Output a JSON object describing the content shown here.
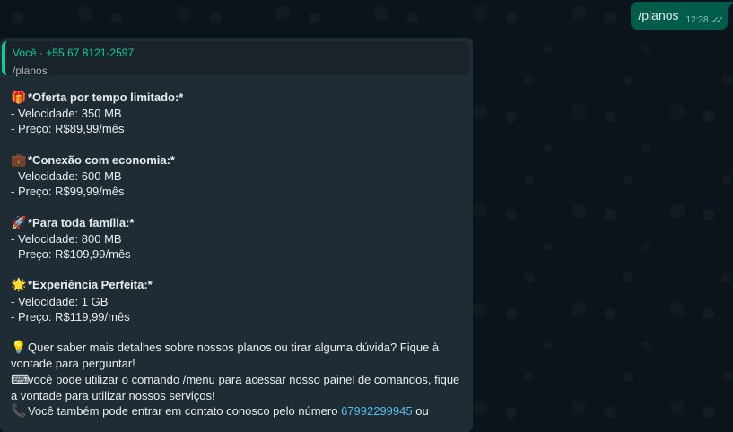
{
  "chat": {
    "outgoing": {
      "text": "/planos",
      "time": "12:38",
      "ticks": "✓✓"
    },
    "incoming": {
      "quote_author": "Você · +55 67 8121-2597",
      "quote_text": "/planos",
      "plans": [
        {
          "emoji": "🎁",
          "title": "*Oferta por tempo limitado:*",
          "speed": "- Velocidade: 350 MB",
          "price": "- Preço: R$89,99/mês"
        },
        {
          "emoji": "💼",
          "title": "*Conexão com economia:*",
          "speed": "- Velocidade: 600 MB",
          "price": "- Preço: R$99,99/mês"
        },
        {
          "emoji": "🚀",
          "title": "*Para toda família:*",
          "speed": "- Velocidade: 800 MB",
          "price": "- Preço: R$109,99/mês"
        },
        {
          "emoji": "🌟",
          "title": "*Experiência Perfeita:*",
          "speed": "- Velocidade: 1 GB",
          "price": "- Preço: R$119,99/mês"
        }
      ],
      "info_emoji": "💡",
      "info_text": "Quer saber mais detalhes sobre nossos planos ou tirar alguma dúvida? Fique à vontade para perguntar!",
      "menu_emoji": "⌨",
      "menu_text": "você pode utilizar o comando /menu para acessar nosso painel de comandos, fique a vontade para utilizar nossos serviços!",
      "contact_emoji": "📞",
      "contact_text": "Você também pode entrar em contato conosco pelo número",
      "contact_number": "67992299945",
      "contact_suffix": "ou"
    }
  }
}
